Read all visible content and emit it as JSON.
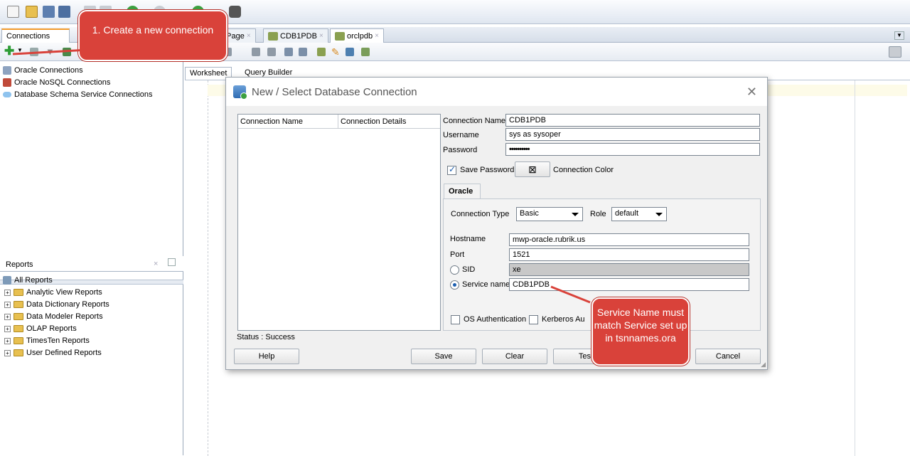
{
  "left_panel": {
    "connections_tab": "Connections",
    "connection_items": [
      "Oracle Connections",
      "Oracle NoSQL Connections",
      "Database Schema Service Connections"
    ],
    "reports_tab": "Reports",
    "reports_root": "All Reports",
    "report_items": [
      "Analytic View Reports",
      "Data Dictionary Reports",
      "Data Modeler Reports",
      "OLAP Reports",
      "TimesTen Reports",
      "User Defined Reports"
    ]
  },
  "editor": {
    "tabs": [
      "e Page",
      "CDB1PDB",
      "orclpdb"
    ],
    "sub_tabs": [
      "Worksheet",
      "Query Builder"
    ]
  },
  "dialog": {
    "title": "New / Select Database Connection",
    "list_headers": [
      "Connection Name",
      "Connection Details"
    ],
    "status": "Status : Success",
    "connection_name_label": "Connection Name",
    "connection_name_value": "CDB1PDB",
    "username_label": "Username",
    "username_value": "sys as sysoper",
    "password_label": "Password",
    "password_value": "••••••••••",
    "save_password_label": "Save Password",
    "connection_color_label": "Connection Color",
    "oracle_tab": "Oracle",
    "connection_type_label": "Connection Type",
    "connection_type_value": "Basic",
    "role_label": "Role",
    "role_value": "default",
    "hostname_label": "Hostname",
    "hostname_value": "mwp-oracle.rubrik.us",
    "port_label": "Port",
    "port_value": "1521",
    "sid_label": "SID",
    "sid_value": "xe",
    "service_name_label": "Service name",
    "service_name_value": "CDB1PDB",
    "os_auth_label": "OS Authentication",
    "kerberos_label": "Kerberos Au",
    "buttons": {
      "help": "Help",
      "save": "Save",
      "clear": "Clear",
      "test": "Test",
      "cancel": "Cancel"
    }
  },
  "callouts": {
    "create": "1. Create a new connection",
    "service": "Service Name must match Service set up in tsnnames.ora"
  },
  "colors": {
    "callout": "#d9423a",
    "accent": "#1d5fb0"
  }
}
